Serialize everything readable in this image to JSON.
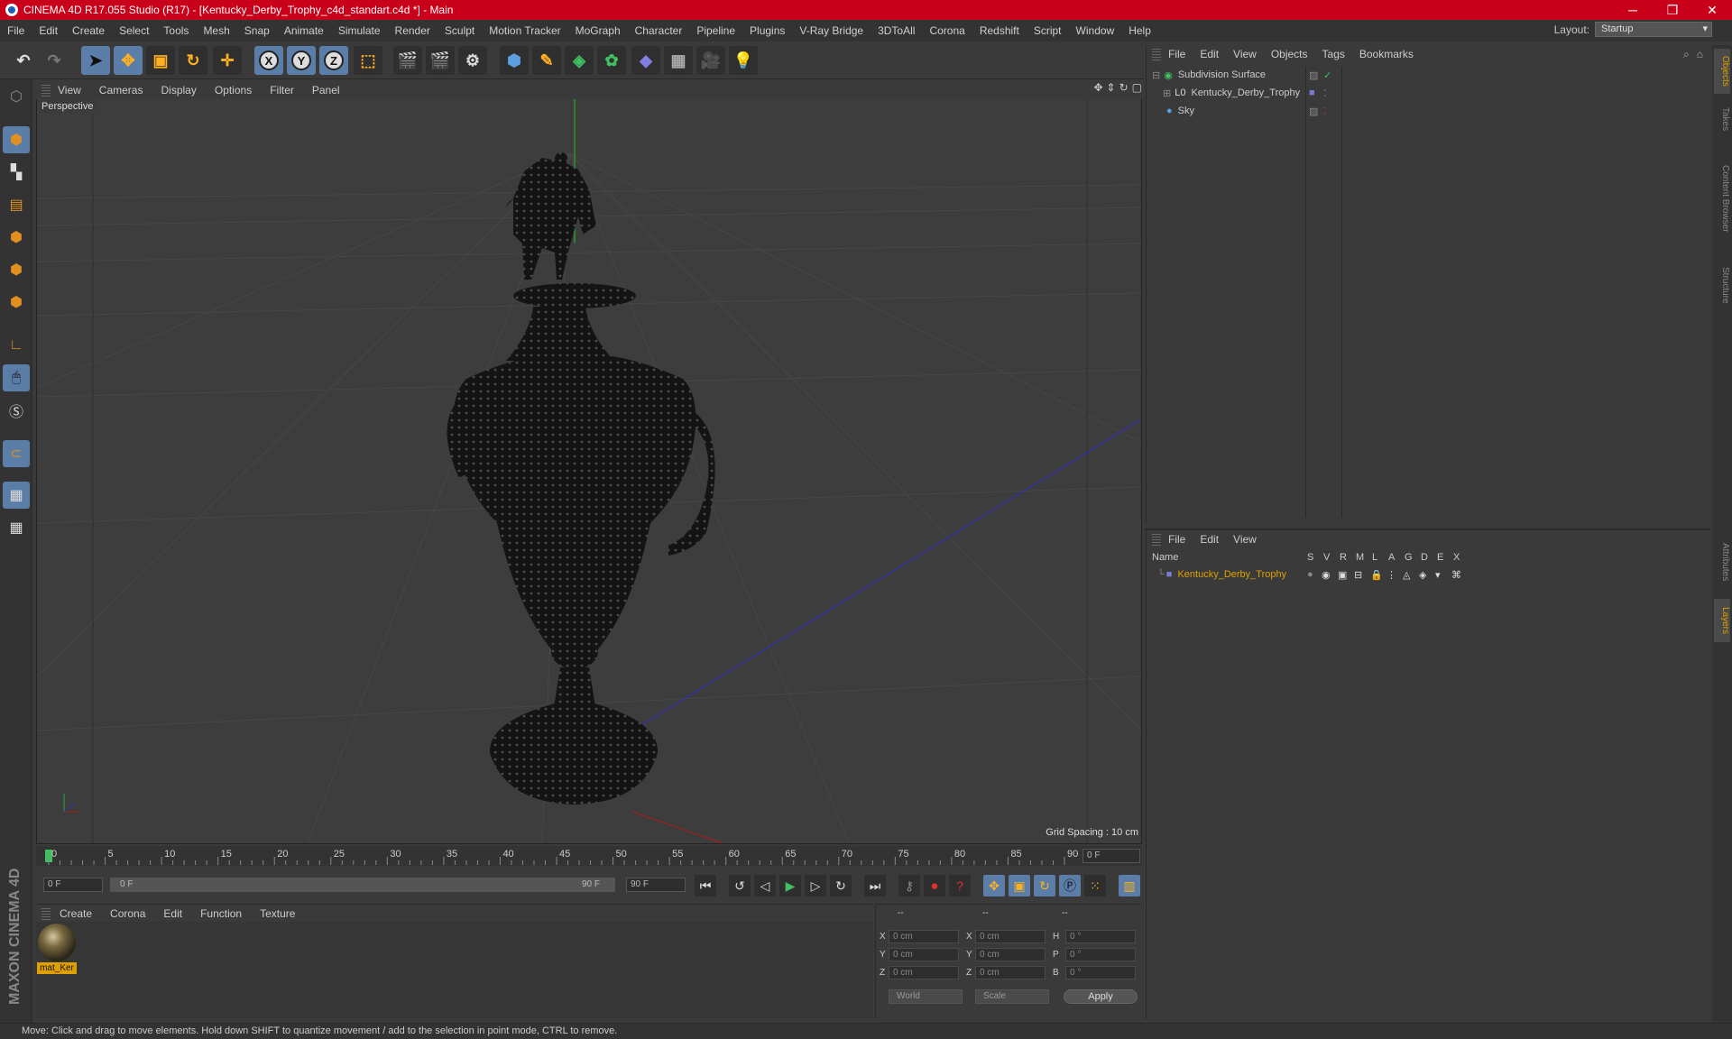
{
  "window": {
    "title": "CINEMA 4D R17.055 Studio (R17) - [Kentucky_Derby_Trophy_c4d_standart.c4d *] - Main",
    "minimize": "─",
    "maximize": "❐",
    "close": "✕"
  },
  "menubar": {
    "items": [
      "File",
      "Edit",
      "Create",
      "Select",
      "Tools",
      "Mesh",
      "Snap",
      "Animate",
      "Simulate",
      "Render",
      "Sculpt",
      "Motion Tracker",
      "MoGraph",
      "Character",
      "Pipeline",
      "Plugins",
      "V-Ray Bridge",
      "3DToAll",
      "Corona",
      "Redshift",
      "Script",
      "Window",
      "Help"
    ],
    "layout_label": "Layout:",
    "layout_value": "Startup"
  },
  "toolbar": {
    "axis_x": "X",
    "axis_y": "Y",
    "axis_z": "Z"
  },
  "viewport": {
    "menu": [
      "View",
      "Cameras",
      "Display",
      "Options",
      "Filter",
      "Panel"
    ],
    "camera_label": "Perspective",
    "grid_spacing": "Grid Spacing : 10 cm"
  },
  "timeline": {
    "ticks": [
      "0",
      "5",
      "10",
      "15",
      "20",
      "25",
      "30",
      "35",
      "40",
      "45",
      "50",
      "55",
      "60",
      "65",
      "70",
      "75",
      "80",
      "85",
      "90"
    ],
    "current_frame": "0 F",
    "start_field": "0 F",
    "slider_start": "0 F",
    "slider_end": "90 F",
    "end_field": "90 F"
  },
  "material_manager": {
    "menu": [
      "Create",
      "Corona",
      "Edit",
      "Function",
      "Texture"
    ],
    "materials": [
      {
        "name": "mat_Ker"
      }
    ]
  },
  "coordinates": {
    "headers": [
      "--",
      "--",
      "--"
    ],
    "rows": [
      {
        "a": "X",
        "av": "0 cm",
        "b": "X",
        "bv": "0 cm",
        "c": "H",
        "cv": "0 °"
      },
      {
        "a": "Y",
        "av": "0 cm",
        "b": "Y",
        "bv": "0 cm",
        "c": "P",
        "cv": "0 °"
      },
      {
        "a": "Z",
        "av": "0 cm",
        "b": "Z",
        "bv": "0 cm",
        "c": "B",
        "cv": "0 °"
      }
    ],
    "world": "World",
    "scale": "Scale",
    "apply": "Apply"
  },
  "object_manager": {
    "menu": [
      "File",
      "Edit",
      "View",
      "Objects",
      "Tags",
      "Bookmarks"
    ],
    "objects": [
      {
        "name": "Subdivision Surface"
      },
      {
        "name": "Kentucky_Derby_Trophy"
      },
      {
        "name": "Sky"
      }
    ]
  },
  "layer_manager": {
    "menu": [
      "File",
      "Edit",
      "View"
    ],
    "col_name": "Name",
    "cols": [
      "S",
      "V",
      "R",
      "M",
      "L",
      "A",
      "G",
      "D",
      "E",
      "X"
    ],
    "layers": [
      {
        "name": "Kentucky_Derby_Trophy"
      }
    ]
  },
  "right_tabs": [
    "Objects",
    "Takes",
    "Content Browser",
    "Structure",
    "Attributes",
    "Layers"
  ],
  "status": "Move: Click and drag to move elements. Hold down SHIFT to quantize movement / add to the selection in point mode, CTRL to remove.",
  "brand": "MAXON CINEMA 4D",
  "colors": {
    "title_bar": "#c8001a",
    "accent": "#e0a000",
    "highlight": "#5b7ea8"
  }
}
